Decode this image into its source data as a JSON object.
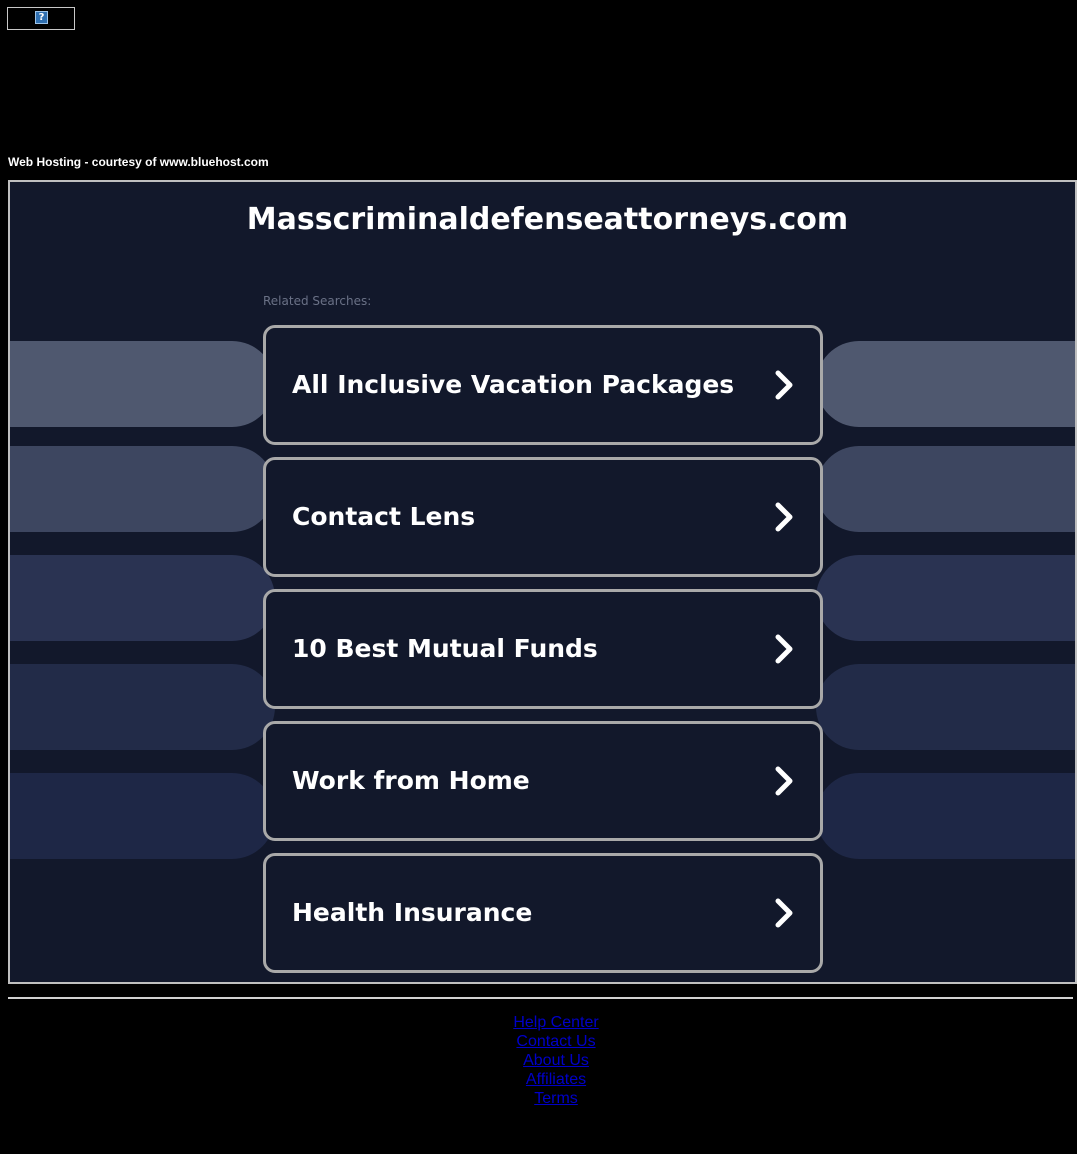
{
  "ad_placeholder_glyph": "?",
  "hosting_note": "Web Hosting - courtesy of www.bluehost.com",
  "domain": "Masscriminaldefenseattorneys.com",
  "related_label": "Related Searches:",
  "searches": [
    {
      "label": "All Inclusive Vacation Packages",
      "icon": "chevron-right-icon"
    },
    {
      "label": "Contact Lens",
      "icon": "chevron-right-icon"
    },
    {
      "label": "10 Best Mutual Funds",
      "icon": "chevron-right-icon"
    },
    {
      "label": "Work from Home",
      "icon": "chevron-right-icon"
    },
    {
      "label": "Health Insurance",
      "icon": "chevron-right-icon"
    }
  ],
  "footer_links": [
    "Help Center",
    "Contact Us",
    "About Us",
    "Affiliates",
    "Terms"
  ],
  "colors": {
    "page_bg": "#000000",
    "panel_bg": "#12182b",
    "card_border": "#a9a9a9",
    "link": "#0000c8",
    "pill_shades": [
      "#4f586f",
      "#3d4660",
      "#2a3352",
      "#222b48",
      "#1e2746"
    ]
  }
}
